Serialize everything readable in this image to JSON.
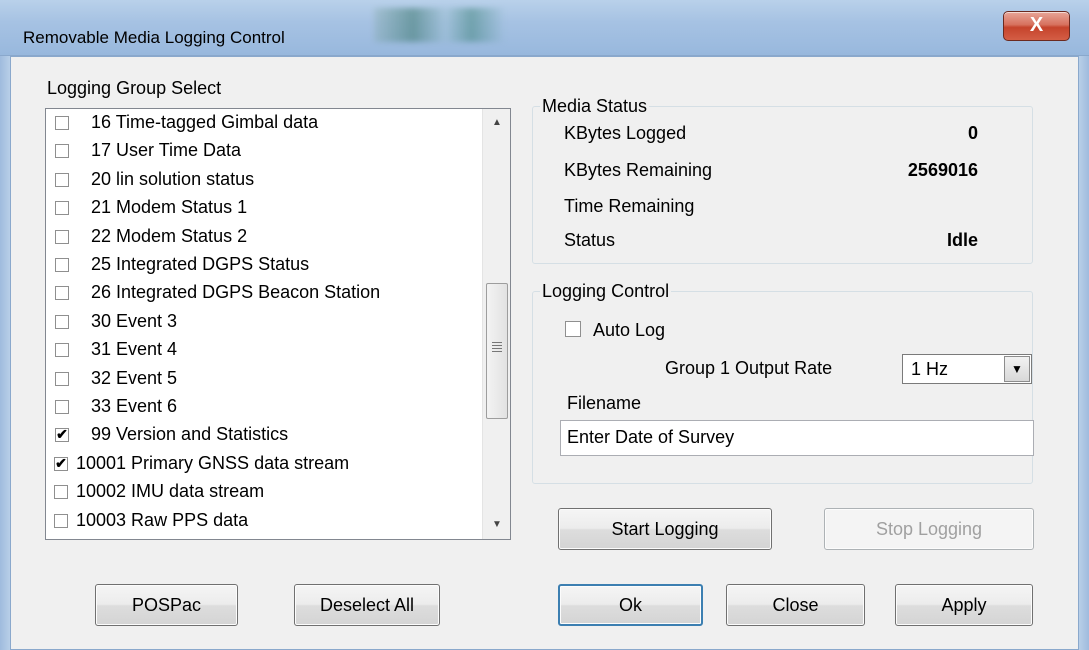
{
  "window": {
    "title": "Removable Media Logging Control",
    "close_label": "X"
  },
  "logging_group": {
    "title": "Logging Group Select",
    "items": [
      {
        "label": "16 Time-tagged Gimbal data",
        "checked": false
      },
      {
        "label": "17 User Time Data",
        "checked": false
      },
      {
        "label": "20 lin solution status",
        "checked": false
      },
      {
        "label": "21 Modem Status 1",
        "checked": false
      },
      {
        "label": "22 Modem Status 2",
        "checked": false
      },
      {
        "label": "25 Integrated DGPS Status",
        "checked": false
      },
      {
        "label": "26 Integrated DGPS Beacon Station",
        "checked": false
      },
      {
        "label": "30 Event 3",
        "checked": false
      },
      {
        "label": "31 Event 4",
        "checked": false
      },
      {
        "label": "32 Event 5",
        "checked": false
      },
      {
        "label": "33 Event 6",
        "checked": false
      },
      {
        "label": "99 Version and Statistics",
        "checked": true
      },
      {
        "label": "10001 Primary GNSS data stream",
        "checked": true
      },
      {
        "label": "10002 IMU data stream",
        "checked": false
      },
      {
        "label": "10003 Raw PPS data",
        "checked": false
      }
    ],
    "scroll_up_icon": "triangle-up",
    "scroll_down_icon": "triangle-down"
  },
  "media_status": {
    "title": "Media Status",
    "kbytes_logged_label": "KBytes Logged",
    "kbytes_logged_value": "0",
    "kbytes_remaining_label": "KBytes Remaining",
    "kbytes_remaining_value": "2569016",
    "time_remaining_label": "Time Remaining",
    "time_remaining_value": "",
    "status_label": "Status",
    "status_value": "Idle"
  },
  "logging_control": {
    "title": "Logging Control",
    "auto_log_label": "Auto Log",
    "auto_log_checked": false,
    "output_rate_label": "Group 1 Output Rate",
    "output_rate_value": "1 Hz",
    "filename_label": "Filename",
    "filename_value": "Enter Date of Survey"
  },
  "buttons": {
    "start_logging": "Start Logging",
    "stop_logging": "Stop Logging",
    "pospac": "POSPac",
    "deselect_all": "Deselect All",
    "ok": "Ok",
    "close": "Close",
    "apply": "Apply"
  }
}
